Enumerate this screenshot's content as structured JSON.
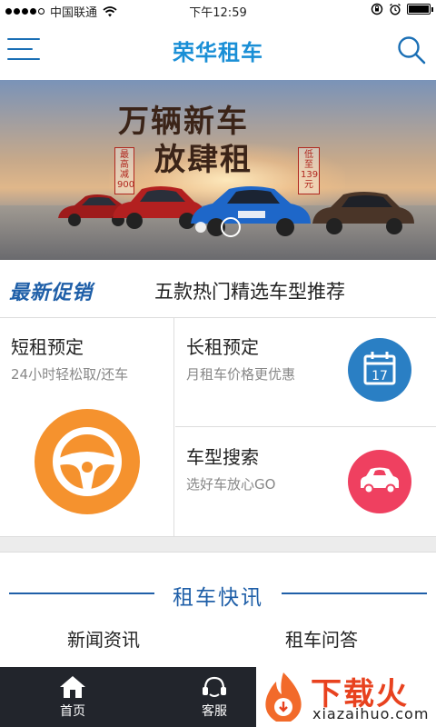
{
  "status_bar": {
    "carrier": "中国联通",
    "time": "下午12:59"
  },
  "header": {
    "title": "荣华租车"
  },
  "banner": {
    "headline_line1": "万辆新车",
    "headline_line2": "放肆租",
    "tag_left": "最高减900",
    "tag_right": "低至139元",
    "page_count": 2,
    "active_page": 2
  },
  "promo": {
    "title": "最新促销",
    "text": "五款热门精选车型推荐"
  },
  "services": {
    "short_rent": {
      "title": "短租预定",
      "subtitle": "24小时轻松取/还车",
      "icon": "steering-wheel-icon",
      "color": "#f5922e"
    },
    "long_rent": {
      "title": "长租预定",
      "subtitle": "月租车价格更优惠",
      "icon": "calendar-icon",
      "icon_text": "17",
      "color": "#2a7fc4"
    },
    "model_search": {
      "title": "车型搜索",
      "subtitle": "选好车放心GO",
      "icon": "car-icon",
      "color": "#ef4060"
    }
  },
  "news": {
    "title": "租车快讯",
    "tabs": [
      "新闻资讯",
      "租车问答"
    ]
  },
  "tab_bar": {
    "items": [
      {
        "label": "首页",
        "icon": "home-icon"
      },
      {
        "label": "客服",
        "icon": "customer-service-icon"
      }
    ]
  },
  "watermark": {
    "main": "下载火",
    "sub": "xiazaihuo.com"
  },
  "colors": {
    "brand_blue": "#1a8fd6",
    "promo_blue": "#1f5fa8",
    "tab_bar_bg": "#22252c"
  }
}
